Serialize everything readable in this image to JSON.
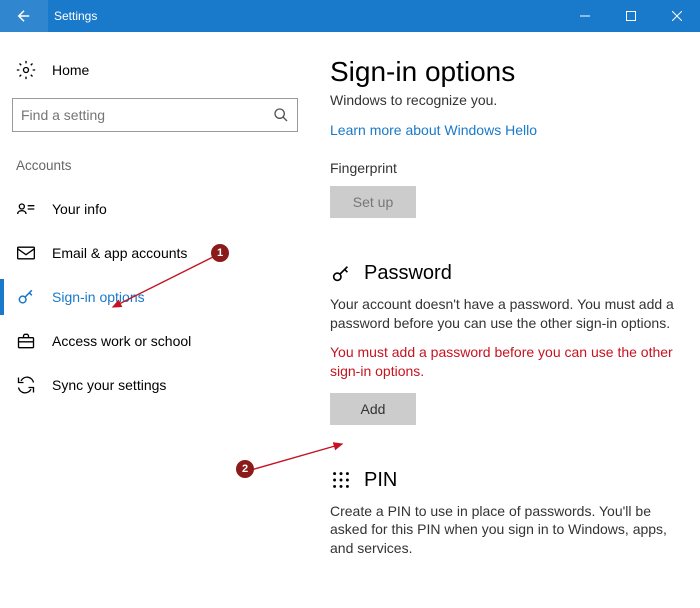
{
  "titlebar": {
    "title": "Settings"
  },
  "sidebar": {
    "home": "Home",
    "search_placeholder": "Find a setting",
    "section": "Accounts",
    "items": [
      {
        "label": "Your info"
      },
      {
        "label": "Email & app accounts"
      },
      {
        "label": "Sign-in options"
      },
      {
        "label": "Access work or school"
      },
      {
        "label": "Sync your settings"
      }
    ]
  },
  "main": {
    "heading": "Sign-in options",
    "subtext": "Windows to recognize you.",
    "link": "Learn more about Windows Hello",
    "fingerprint_label": "Fingerprint",
    "setup_btn": "Set up",
    "password_title": "Password",
    "password_desc": "Your account doesn't have a password. You must add a password before you can use the other sign-in options.",
    "password_error": "You must add a password before you can use the other sign-in options.",
    "add_btn": "Add",
    "pin_title": "PIN",
    "pin_desc": "Create a PIN to use in place of passwords. You'll be asked for this PIN when you sign in to Windows, apps, and services."
  },
  "annotations": {
    "n1": "1",
    "n2": "2"
  }
}
